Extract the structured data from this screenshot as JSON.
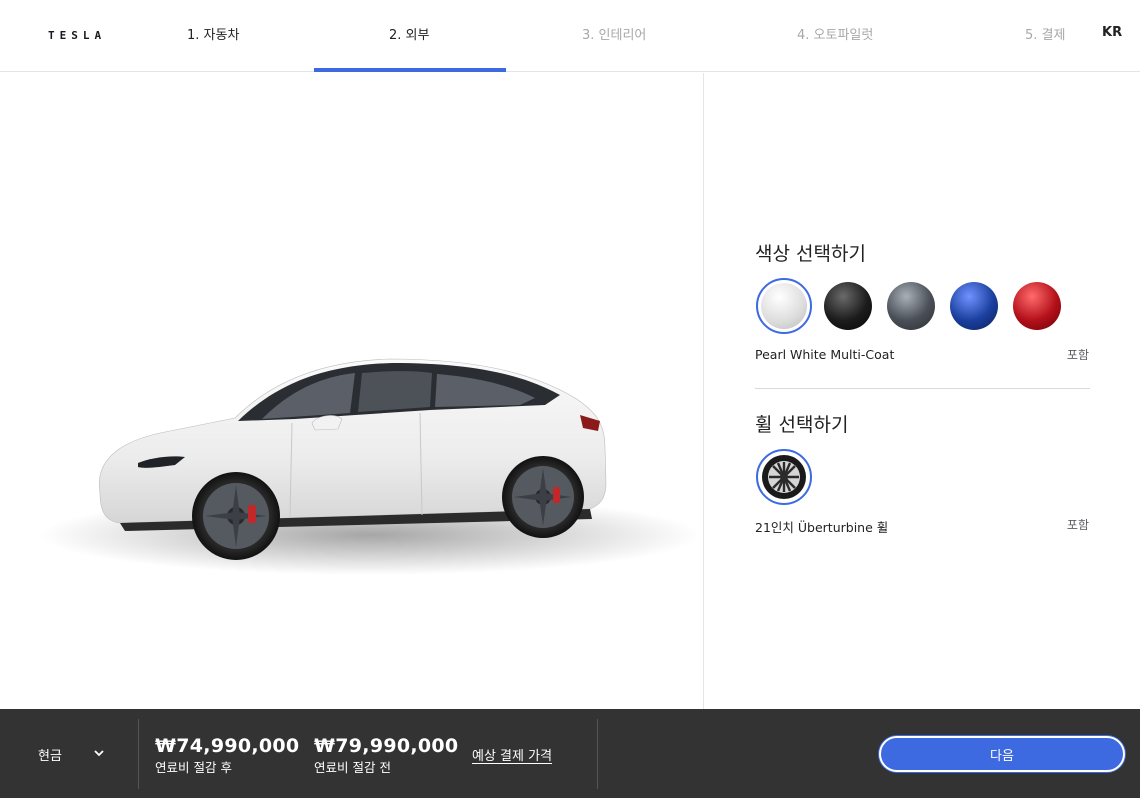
{
  "header": {
    "logo_text": "TESLA",
    "steps": [
      {
        "label": "1. 자동차"
      },
      {
        "label": "2. 외부"
      },
      {
        "label": "3. 인테리어"
      },
      {
        "label": "4. 오토파일럿"
      },
      {
        "label": "5. 결제"
      }
    ],
    "active_step": 2,
    "language": "KR"
  },
  "colors": {
    "accent": "#3e6ae1",
    "footer_bg": "#333333"
  },
  "paint": {
    "title": "색상 선택하기",
    "swatches": [
      {
        "name": "pearl-white",
        "color": "#ececec",
        "selected": true
      },
      {
        "name": "solid-black",
        "color": "#1c1c1c",
        "selected": false
      },
      {
        "name": "midnight-silver",
        "color": "#4a4f57",
        "selected": false
      },
      {
        "name": "deep-blue",
        "color": "#1b3f9e",
        "selected": false
      },
      {
        "name": "red-multi-coat",
        "color": "#b3101a",
        "selected": false
      }
    ],
    "selected_name": "Pearl White Multi-Coat",
    "selected_price": "포함"
  },
  "wheels": {
    "title": "휠 선택하기",
    "selected_name": "21인치 Überturbine 휠",
    "selected_price": "포함"
  },
  "footer": {
    "payment_type": "현금",
    "price_after": "₩74,990,000",
    "price_after_label": "연료비 절감 후",
    "price_before": "₩79,990,000",
    "price_before_label": "연료비 절감 전",
    "estimate_link": "예상 결제 가격",
    "next_button": "다음"
  }
}
